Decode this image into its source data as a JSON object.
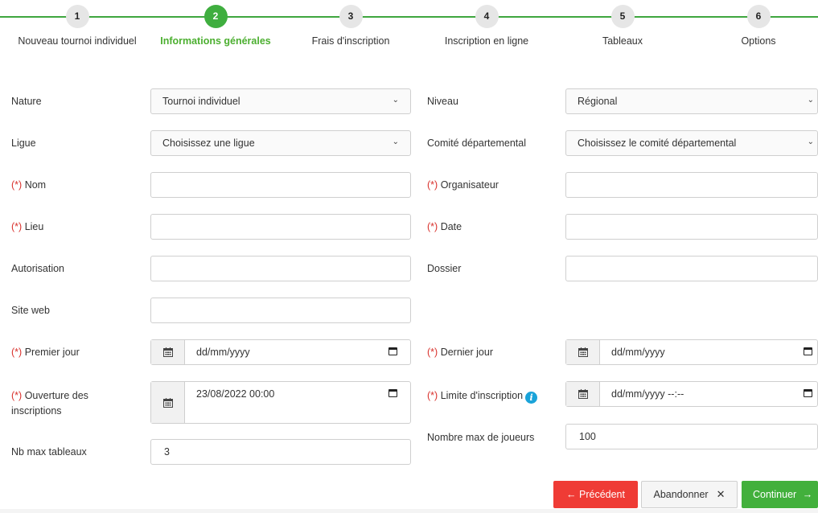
{
  "stepper": {
    "active_index": 1,
    "steps": [
      {
        "number": "1",
        "label": "Nouveau tournoi individuel"
      },
      {
        "number": "2",
        "label": "Informations générales"
      },
      {
        "number": "3",
        "label": "Frais d'inscription"
      },
      {
        "number": "4",
        "label": "Inscription en ligne"
      },
      {
        "number": "5",
        "label": "Tableaux"
      },
      {
        "number": "6",
        "label": "Options"
      }
    ]
  },
  "form": {
    "required_marker": "(*)",
    "nature": {
      "label": "Nature",
      "value": "Tournoi individuel"
    },
    "niveau": {
      "label": "Niveau",
      "value": "Régional"
    },
    "ligue": {
      "label": "Ligue",
      "value": "Choisissez une ligue"
    },
    "comite": {
      "label": "Comité départemental",
      "value": "Choisissez le comité départemental"
    },
    "nom": {
      "label": "Nom",
      "value": ""
    },
    "organisateur": {
      "label": "Organisateur",
      "value": ""
    },
    "lieu": {
      "label": "Lieu",
      "value": ""
    },
    "date": {
      "label": "Date",
      "value": ""
    },
    "autorisation": {
      "label": "Autorisation",
      "value": ""
    },
    "dossier": {
      "label": "Dossier",
      "value": ""
    },
    "site_web": {
      "label": "Site web",
      "value": ""
    },
    "premier_jour": {
      "label": "Premier jour",
      "value": "dd/mm/yyyy"
    },
    "dernier_jour": {
      "label": "Dernier jour",
      "value": "dd/mm/yyyy"
    },
    "ouverture": {
      "label_line1": "Ouverture des",
      "label_line2": "inscriptions",
      "value": "23/08/2022 00:00"
    },
    "limite": {
      "label": "Limite d'inscription",
      "value": "dd/mm/yyyy --:--"
    },
    "nb_max_tableaux": {
      "label": "Nb max tableaux",
      "value": "3"
    },
    "nb_max_joueurs": {
      "label": "Nombre max de joueurs",
      "value": "100"
    }
  },
  "buttons": {
    "previous": "Précédent",
    "abandon": "Abandonner",
    "continue": "Continuer"
  },
  "colors": {
    "accent_green": "#3fae3f",
    "danger_red": "#ef3b35",
    "info_blue": "#1aa3d9"
  }
}
